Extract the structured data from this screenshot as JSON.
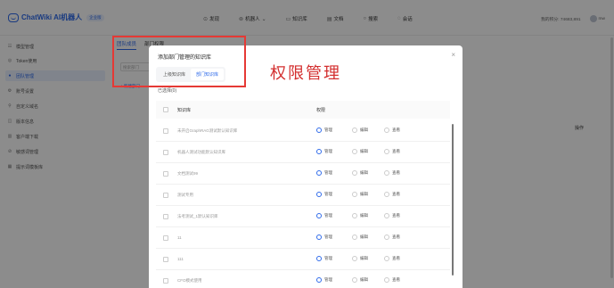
{
  "header": {
    "app_name": "ChatWiki AI机器人",
    "badge": "企业版",
    "nav": [
      {
        "label": "发现",
        "icon": "discover-icon"
      },
      {
        "label": "机器人",
        "icon": "robot-icon"
      },
      {
        "label": "知识库",
        "icon": "book-icon"
      },
      {
        "label": "文档",
        "icon": "doc-icon"
      },
      {
        "label": "搜索",
        "icon": "search-icon"
      },
      {
        "label": "会话",
        "icon": "chat-icon"
      }
    ],
    "points": "我的积分: 74683,891",
    "user": "mw"
  },
  "sidebar": {
    "items": [
      {
        "label": "模型管理",
        "icon": "model-icon"
      },
      {
        "label": "Token使用",
        "icon": "token-icon"
      },
      {
        "label": "团队管理",
        "icon": "team-icon",
        "active": true
      },
      {
        "label": "账号设置",
        "icon": "account-icon"
      },
      {
        "label": "自定义域名",
        "icon": "domain-icon"
      },
      {
        "label": "版本信息",
        "icon": "version-icon"
      },
      {
        "label": "客户端下载",
        "icon": "download-icon"
      },
      {
        "label": "敏感词管理",
        "icon": "shield-icon"
      },
      {
        "label": "提示词模板库",
        "icon": "template-icon"
      }
    ]
  },
  "main": {
    "tabs": [
      "团队成员",
      "部门权限"
    ],
    "search_placeholder": "搜索部门",
    "add_label": "+ 新建部门",
    "action_header": "操作"
  },
  "modal": {
    "title": "添加部门管理的知识库",
    "segments": [
      "上级知识库",
      "部门知识库"
    ],
    "active_segment": 1,
    "selected_count": "已选择(0)",
    "col_kb": "知识库",
    "col_perm": "权限",
    "perm_labels": [
      "管理",
      "编辑",
      "查看"
    ],
    "rows": [
      {
        "name": "未开启GraphRAG测试默认知识库",
        "perm": 0
      },
      {
        "name": "机器人测试功能默认知识库",
        "perm": 0
      },
      {
        "name": "文档测试99",
        "perm": 0
      },
      {
        "name": "测试专用",
        "perm": 0
      },
      {
        "name": "法考测试_1默认知识库",
        "perm": 0
      },
      {
        "name": "11",
        "perm": 0
      },
      {
        "name": "111",
        "perm": 0
      },
      {
        "name": "CFO模式使用",
        "perm": 0
      }
    ]
  },
  "annotation": {
    "text": "权限管理",
    "color": "#d32f2f"
  },
  "colors": {
    "accent": "#2f6bea",
    "annotation_box": "#e53935"
  }
}
